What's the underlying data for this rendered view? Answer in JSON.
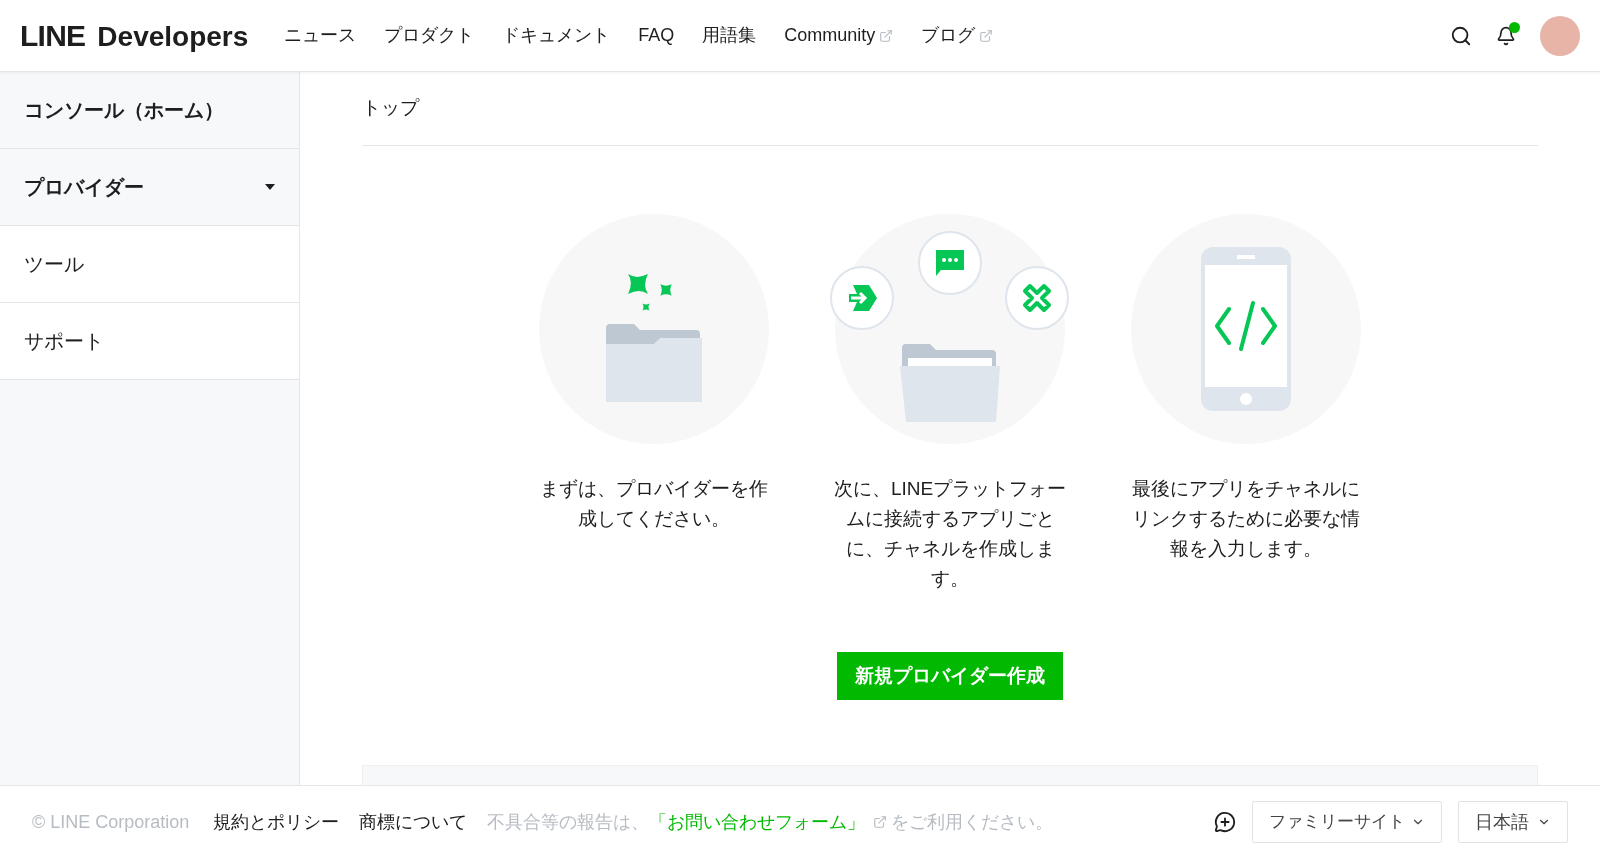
{
  "header": {
    "logo_main": "LINE",
    "logo_sub": "Developers",
    "nav": [
      {
        "label": "ニュース",
        "external": false
      },
      {
        "label": "プロダクト",
        "external": false
      },
      {
        "label": "ドキュメント",
        "external": false
      },
      {
        "label": "FAQ",
        "external": false
      },
      {
        "label": "用語集",
        "external": false
      },
      {
        "label": "Community",
        "external": true
      },
      {
        "label": "ブログ",
        "external": true
      }
    ],
    "notification_unread": true
  },
  "sidebar": {
    "items": [
      {
        "label": "コンソール（ホーム）",
        "kind": "home"
      },
      {
        "label": "プロバイダー",
        "kind": "dropdown"
      },
      {
        "label": "ツール",
        "kind": "link"
      },
      {
        "label": "サポート",
        "kind": "link"
      }
    ]
  },
  "breadcrumb": "トップ",
  "steps": [
    {
      "kind": "provider",
      "text": "まずは、プロバイダーを作成してください。"
    },
    {
      "kind": "channel",
      "text": "次に、LINEプラットフォームに接続するアプリごとに、チャネルを作成します。"
    },
    {
      "kind": "app",
      "text": "最後にアプリをチャネルにリンクするために必要な情報を入力します。"
    }
  ],
  "create_button": "新規プロバイダー作成",
  "footer": {
    "copyright": "© LINE Corporation",
    "links": [
      "規約とポリシー",
      "商標について"
    ],
    "notice_before": "不具合等の報告は、",
    "notice_link": "「お問い合わせフォーム」",
    "notice_after": "をご利用ください。",
    "family_site": "ファミリーサイト",
    "language": "日本語"
  }
}
